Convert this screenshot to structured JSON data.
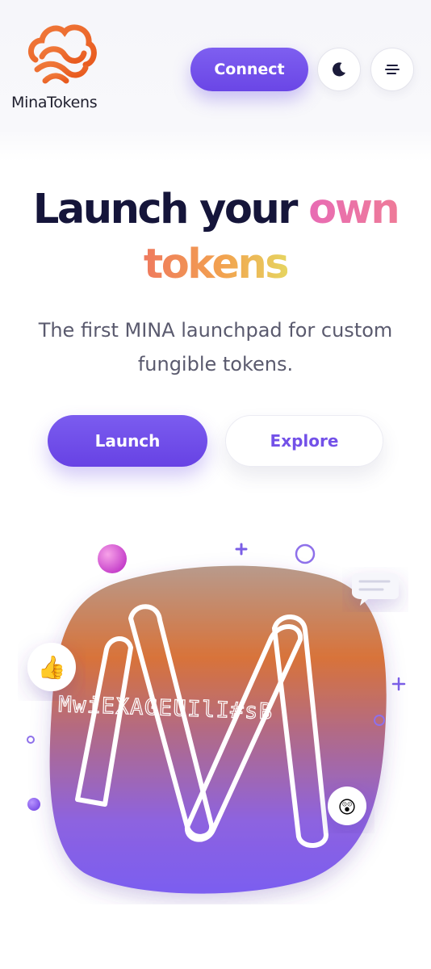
{
  "header": {
    "brand": "MinaTokens",
    "connect_label": "Connect",
    "icons": {
      "logo": "cloud-logo-icon",
      "theme": "moon-icon",
      "menu": "hamburger-menu-icon"
    }
  },
  "hero": {
    "headline_part1": "Launch your ",
    "headline_part2": "own",
    "headline_part3": "tokens",
    "subtitle": "The first MINA launchpad for custom fungible tokens.",
    "launch_label": "Launch",
    "explore_label": "Explore"
  },
  "illustration": {
    "glitch_text": "MwiEXAGEUIlI#sB",
    "emoji_thumbs": "👍",
    "emoji_wow": "😲",
    "icons": [
      "big-m-letter-icon",
      "chat-bubble-icon",
      "plus-icon",
      "ring-icon",
      "sphere-icon"
    ]
  },
  "colors": {
    "primary": "#6a46e6",
    "brand_orange": "#ef6a2a",
    "headline": "#15153a"
  }
}
